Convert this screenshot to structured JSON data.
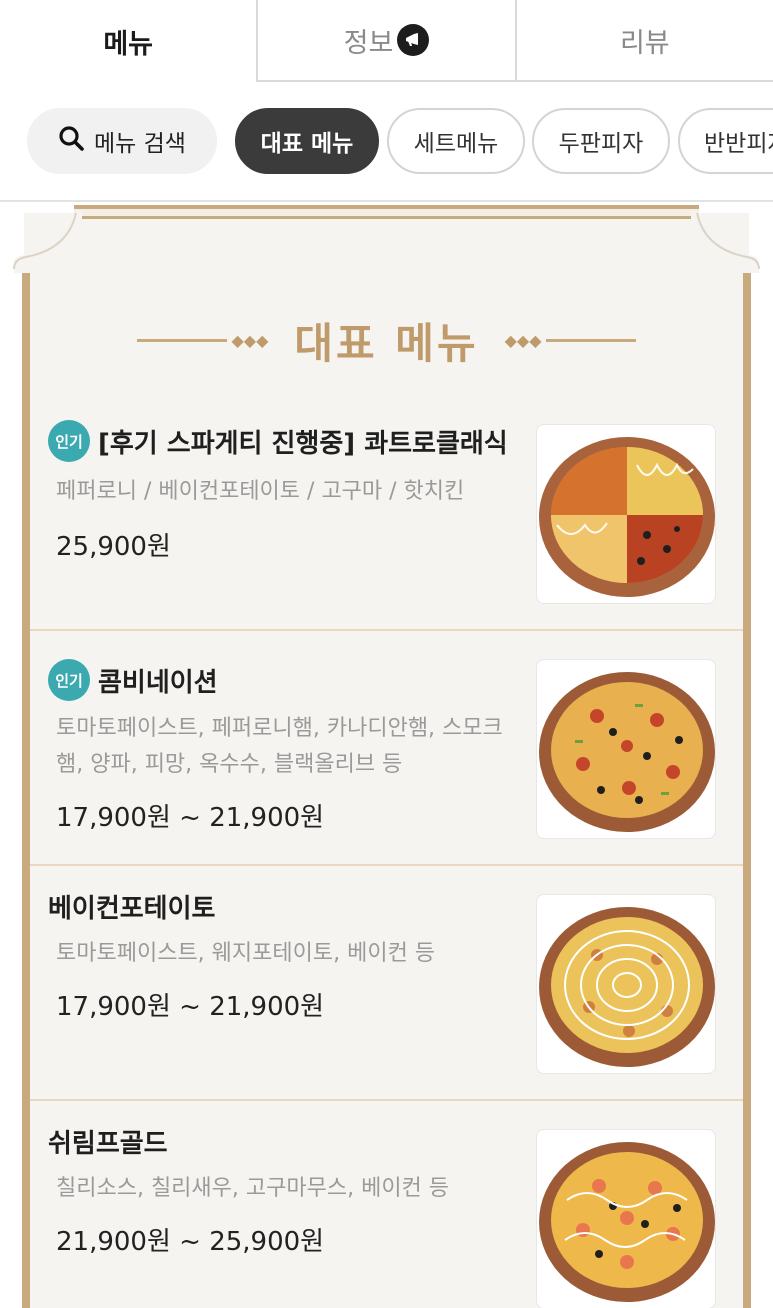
{
  "tabs": [
    {
      "label": "메뉴",
      "active": true
    },
    {
      "label": "정보",
      "active": false
    },
    {
      "label": "리뷰",
      "active": false
    }
  ],
  "chips": {
    "search_label": "메뉴 검색",
    "items": [
      "대표 메뉴",
      "세트메뉴",
      "두판피자",
      "반반피자"
    ]
  },
  "section": {
    "title": "대표 메뉴"
  },
  "menu_items": [
    {
      "badge": "인기",
      "name": "[후기 스파게티 진행중] 콰트로클래식",
      "desc": "페퍼로니 / 베이컨포테이토 / 고구마 / 핫치킨",
      "price": "25,900원"
    },
    {
      "badge": "인기",
      "name": "콤비네이션",
      "desc": "토마토페이스트, 페퍼로니햄, 카나디안햄, 스모크햄, 양파, 피망, 옥수수, 블랙올리브 등",
      "price": "17,900원 ~ 21,900원"
    },
    {
      "badge": "",
      "name": "베이컨포테이토",
      "desc": "토마토페이스트, 웨지포테이토, 베이컨 등",
      "price": "17,900원 ~ 21,900원"
    },
    {
      "badge": "",
      "name": "쉬림프골드",
      "desc": "칠리소스, 칠리새우, 고구마무스, 베이컨 등",
      "price": "21,900원 ~ 25,900원"
    }
  ],
  "colors": {
    "accent_gold": "#c9a97e",
    "badge_teal": "#3aa9b0",
    "chip_active": "#3b3b3b"
  }
}
